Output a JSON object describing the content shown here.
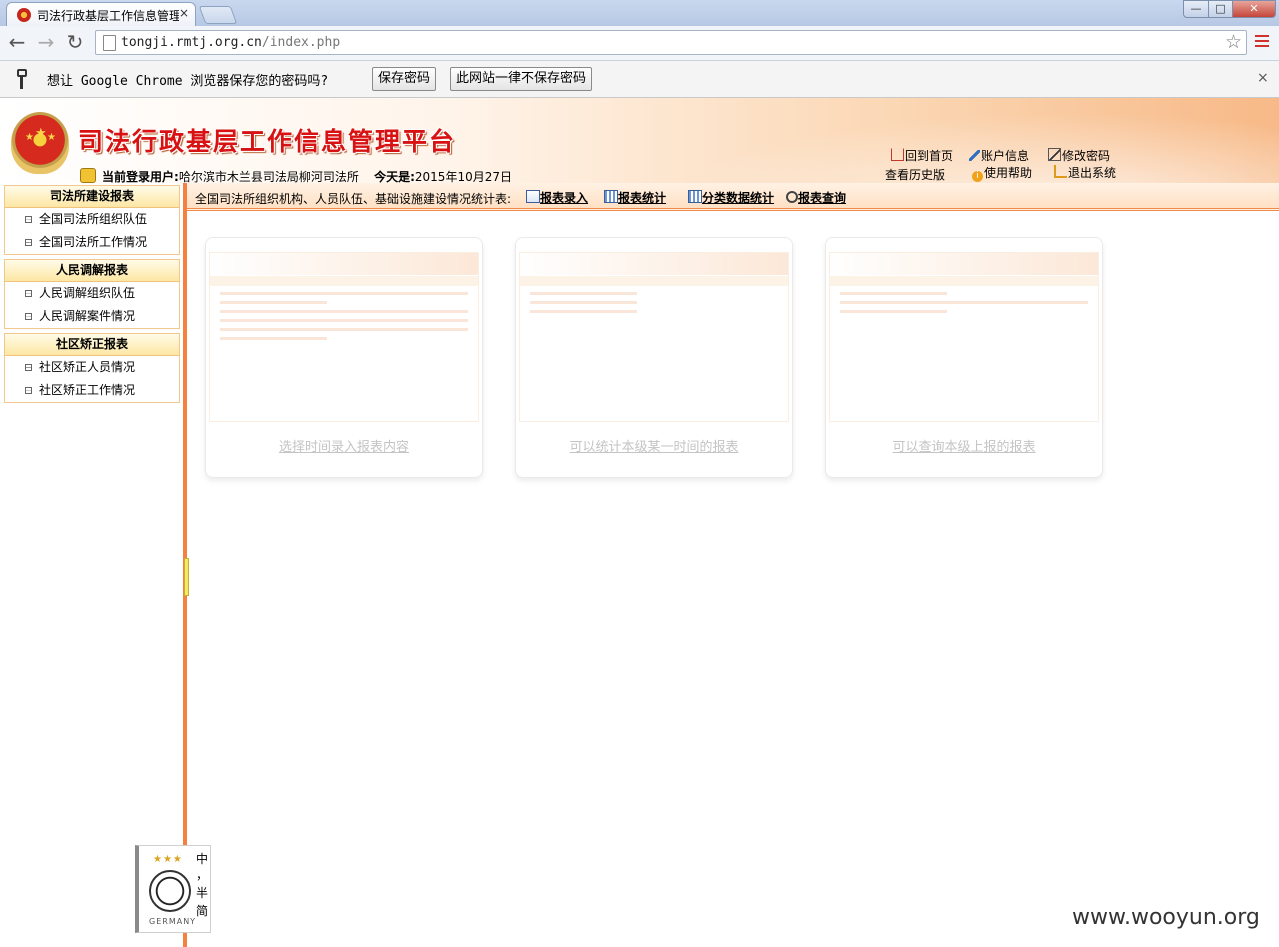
{
  "browser": {
    "tab_title": "司法行政基层工作信息管理",
    "tab_close": "×",
    "url_host": "tongji.rmtj.org.cn",
    "url_path": "/index.php",
    "window_controls": {
      "min": "—",
      "max": "□",
      "close": "✕"
    },
    "nav": {
      "back": "←",
      "forward": "→",
      "reload": "↻"
    },
    "star": "☆"
  },
  "infobar": {
    "message": "想让 Google Chrome 浏览器保存您的密码吗?",
    "save_button": "保存密码",
    "never_button": "此网站一律不保存密码",
    "close": "×"
  },
  "header": {
    "title": "司法行政基层工作信息管理平台",
    "user_label": "当前登录用户:",
    "user_value": "哈尔滨市木兰县司法局柳河司法所",
    "date_label": "今天是:",
    "date_value": "2015年10月27日",
    "links": {
      "home": "回到首页",
      "account": "账户信息",
      "password": "修改密码",
      "history": "查看历史版",
      "help": "使用帮助",
      "logout": "退出系统"
    }
  },
  "navbar": {
    "label": "全国司法所组织机构、人员队伍、基础设施建设情况统计表:",
    "links": {
      "entry": "报表录入",
      "stats": "报表统计",
      "category": "分类数据统计",
      "query": "报表查询"
    }
  },
  "sidebar": {
    "sections": [
      {
        "title": "司法所建设报表",
        "items": [
          "全国司法所组织队伍",
          "全国司法所工作情况"
        ]
      },
      {
        "title": "人民调解报表",
        "items": [
          "人民调解组织队伍",
          "人民调解案件情况"
        ]
      },
      {
        "title": "社区矫正报表",
        "items": [
          "社区矫正人员情况",
          "社区矫正工作情况"
        ]
      }
    ]
  },
  "cards": [
    {
      "caption": "选择时间录入报表内容"
    },
    {
      "caption": "可以统计本级某一时间的报表"
    },
    {
      "caption": "可以查询本级上报的报表"
    }
  ],
  "widget": {
    "stars": "★★★",
    "brand": "GERMANY",
    "side_text": [
      "中",
      "，",
      "半",
      "简"
    ]
  },
  "watermark": "www.wooyun.org",
  "colors": {
    "accent_orange": "#f4813f",
    "title_red": "#d81212",
    "sidebar_header": "#fde7a4"
  }
}
